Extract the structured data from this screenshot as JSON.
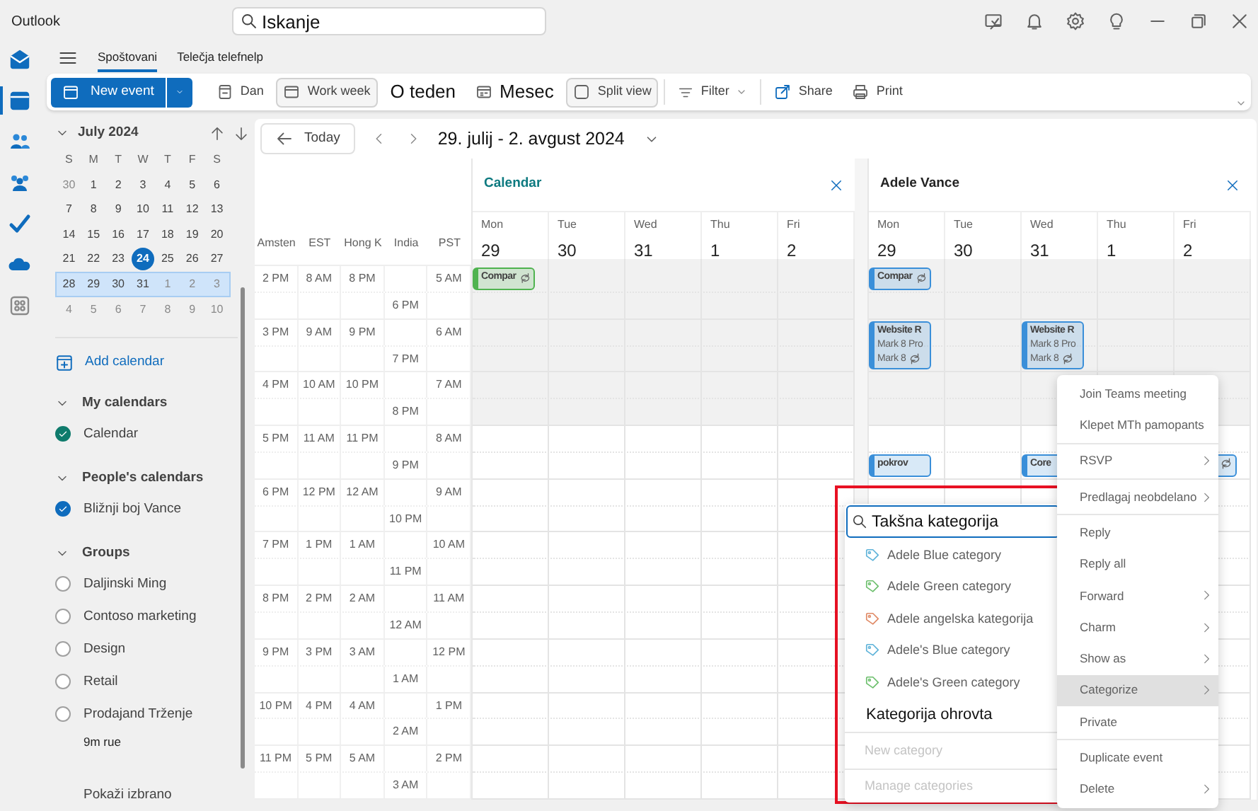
{
  "title_bar": {
    "app_name": "Outlook",
    "search": {
      "placeholder": "Iskanje"
    }
  },
  "ribbon_tabs": [
    {
      "label": "Spoštovani",
      "selected": true
    },
    {
      "label": "Telečja telefnelp",
      "selected": false
    }
  ],
  "toolbar": {
    "new_event": {
      "label": "New event"
    },
    "views": [
      {
        "label": "Dan",
        "selected": false
      },
      {
        "label": "Work week",
        "selected": true
      },
      {
        "label": "O teden",
        "selected": false
      },
      {
        "label": "Mesec",
        "selected": false
      },
      {
        "label": "Split view",
        "selected": true
      }
    ],
    "filter": {
      "label": "Filter"
    },
    "actions": [
      {
        "label": "Share"
      },
      {
        "label": "Print"
      }
    ]
  },
  "mini_calendar": {
    "month": "July 2024",
    "weekdays": [
      "S",
      "M",
      "T",
      "W",
      "T",
      "F",
      "S"
    ],
    "weeks": [
      {
        "selected": false,
        "days": [
          {
            "day": "30",
            "outside": true,
            "today": false
          },
          {
            "day": "1",
            "outside": false,
            "today": false
          },
          {
            "day": "2",
            "outside": false,
            "today": false
          },
          {
            "day": "3",
            "outside": false,
            "today": false
          },
          {
            "day": "4",
            "outside": false,
            "today": false
          },
          {
            "day": "5",
            "outside": false,
            "today": false
          },
          {
            "day": "6",
            "outside": false,
            "today": false
          }
        ]
      },
      {
        "selected": false,
        "days": [
          {
            "day": "7",
            "outside": false,
            "today": false
          },
          {
            "day": "8",
            "outside": false,
            "today": false
          },
          {
            "day": "9",
            "outside": false,
            "today": false
          },
          {
            "day": "10",
            "outside": false,
            "today": false
          },
          {
            "day": "11",
            "outside": false,
            "today": false
          },
          {
            "day": "12",
            "outside": false,
            "today": false
          },
          {
            "day": "13",
            "outside": false,
            "today": false
          }
        ]
      },
      {
        "selected": false,
        "days": [
          {
            "day": "14",
            "outside": false,
            "today": false
          },
          {
            "day": "15",
            "outside": false,
            "today": false
          },
          {
            "day": "16",
            "outside": false,
            "today": false
          },
          {
            "day": "17",
            "outside": false,
            "today": false
          },
          {
            "day": "18",
            "outside": false,
            "today": false
          },
          {
            "day": "19",
            "outside": false,
            "today": false
          },
          {
            "day": "20",
            "outside": false,
            "today": false
          }
        ]
      },
      {
        "selected": false,
        "days": [
          {
            "day": "21",
            "outside": false,
            "today": false
          },
          {
            "day": "22",
            "outside": false,
            "today": false
          },
          {
            "day": "23",
            "outside": false,
            "today": false
          },
          {
            "day": "24",
            "outside": false,
            "today": true
          },
          {
            "day": "25",
            "outside": false,
            "today": false
          },
          {
            "day": "26",
            "outside": false,
            "today": false
          },
          {
            "day": "27",
            "outside": false,
            "today": false
          }
        ]
      },
      {
        "selected": true,
        "days": [
          {
            "day": "28",
            "outside": false,
            "today": false
          },
          {
            "day": "29",
            "outside": false,
            "today": false
          },
          {
            "day": "30",
            "outside": false,
            "today": false
          },
          {
            "day": "31",
            "outside": false,
            "today": false
          },
          {
            "day": "1",
            "outside": true,
            "today": false
          },
          {
            "day": "2",
            "outside": true,
            "today": false
          },
          {
            "day": "3",
            "outside": true,
            "today": false
          }
        ]
      },
      {
        "selected": false,
        "days": [
          {
            "day": "4",
            "outside": true,
            "today": false
          },
          {
            "day": "5",
            "outside": true,
            "today": false
          },
          {
            "day": "6",
            "outside": true,
            "today": false
          },
          {
            "day": "7",
            "outside": true,
            "today": false
          },
          {
            "day": "8",
            "outside": true,
            "today": false
          },
          {
            "day": "9",
            "outside": true,
            "today": false
          },
          {
            "day": "10",
            "outside": true,
            "today": false
          }
        ]
      }
    ]
  },
  "add_calendar": "Add calendar",
  "calendar_groups": [
    {
      "title": "My calendars",
      "expanded": true,
      "items": [
        {
          "label": "Calendar",
          "checked": true,
          "color": "#0f7b6c"
        }
      ]
    },
    {
      "title": "People's calendars",
      "expanded": true,
      "items": [
        {
          "label": "Bližnji boj Vance",
          "checked": true,
          "color": "#0f6cbd"
        }
      ]
    },
    {
      "title": "Groups",
      "expanded": true,
      "items": [
        {
          "label": "Daljinski Ming",
          "checked": false
        },
        {
          "label": "Contoso marketing",
          "checked": false
        },
        {
          "label": "Design",
          "checked": false
        },
        {
          "label": "Retail",
          "checked": false
        },
        {
          "label": "Prodajand Trženje",
          "checked": false
        }
      ]
    }
  ],
  "groups_footer": "9m rue",
  "show_selected": "Pokaži izbrano",
  "navigation": {
    "today": "Today",
    "date_range": "29. julij - 2. avgust 2024"
  },
  "time_zones": {
    "columns": [
      "Amsten",
      "EST",
      "Hong K",
      "India",
      "PST"
    ],
    "rows": [
      {
        "amsterdam": "2 PM",
        "est": "8 AM",
        "hong_kong": "8 PM",
        "india": "6 PM",
        "pst": "5 AM",
        "shaded": true
      },
      {
        "amsterdam": "3 PM",
        "est": "9 AM",
        "hong_kong": "9 PM",
        "india": "7 PM",
        "pst": "6 AM",
        "shaded": true
      },
      {
        "amsterdam": "4 PM",
        "est": "10 AM",
        "hong_kong": "10 PM",
        "india": "8 PM",
        "pst": "7 AM",
        "shaded": true
      },
      {
        "amsterdam": "5 PM",
        "est": "11 AM",
        "hong_kong": "11 PM",
        "india": "9 PM",
        "pst": "8 AM",
        "shaded": false
      },
      {
        "amsterdam": "6 PM",
        "est": "12 PM",
        "hong_kong": "12 AM",
        "india": "10 PM",
        "pst": "9 AM",
        "shaded": false
      },
      {
        "amsterdam": "7 PM",
        "est": "1 PM",
        "hong_kong": "1 AM",
        "india": "11 PM",
        "pst": "10 AM",
        "shaded": false
      },
      {
        "amsterdam": "8 PM",
        "est": "2 PM",
        "hong_kong": "2 AM",
        "india": "12 AM",
        "pst": "11 AM",
        "shaded": false
      },
      {
        "amsterdam": "9 PM",
        "est": "3 PM",
        "hong_kong": "3 AM",
        "india": "1 AM",
        "pst": "12 PM",
        "shaded": false
      },
      {
        "amsterdam": "10 PM",
        "est": "4 PM",
        "hong_kong": "4 AM",
        "india": "2 AM",
        "pst": "1 PM",
        "shaded": false
      },
      {
        "amsterdam": "11 PM",
        "est": "5 PM",
        "hong_kong": "5 AM",
        "india": "3 AM",
        "pst": "2 PM",
        "shaded": false
      }
    ]
  },
  "panels": [
    {
      "title": "Calendar",
      "color": "#0e7a80",
      "days": [
        {
          "name": "Mon",
          "number": "29",
          "slots": [
            {
              "kind": "short_event",
              "title": "Compar",
              "recurring": true,
              "color": "#4fb34f"
            }
          ]
        },
        {
          "name": "Tue",
          "number": "30"
        },
        {
          "name": "Wed",
          "number": "31"
        },
        {
          "name": "Thu",
          "number": "1"
        },
        {
          "name": "Fri",
          "number": "2"
        }
      ]
    },
    {
      "title": "Adele Vance",
      "color": "#242424",
      "days": [
        {
          "name": "Mon",
          "number": "29",
          "slots": [
            {
              "kind": "short_event",
              "title": "Compar",
              "recurring": true,
              "color": "#3a8fd9"
            },
            {
              "kind": "empty"
            },
            {
              "kind": "long_event",
              "title": "Website R",
              "details": [
                "Mark 8 Pro",
                "Mark 8"
              ],
              "recurring": true,
              "color": "#3a8fd9"
            },
            {
              "kind": "empty"
            },
            {
              "kind": "empty"
            },
            {
              "kind": "empty"
            },
            {
              "kind": "short_event",
              "title": "pokrov",
              "recurring": false,
              "color": "#3a8fd9"
            }
          ]
        },
        {
          "name": "Tue",
          "number": "30"
        },
        {
          "name": "Wed",
          "number": "31",
          "slots": [
            {
              "kind": "empty"
            },
            {
              "kind": "empty"
            },
            {
              "kind": "long_event",
              "title": "Website R",
              "details": [
                "Mark 8 Pro",
                "Mark 8"
              ],
              "recurring": true,
              "color": "#3a8fd9"
            },
            {
              "kind": "empty"
            },
            {
              "kind": "empty"
            },
            {
              "kind": "empty"
            },
            {
              "kind": "short_event",
              "title": "Core",
              "recurring": false,
              "color": "#3a8fd9"
            }
          ]
        },
        {
          "name": "Thu",
          "number": "1"
        },
        {
          "name": "Fri",
          "number": "2",
          "slots": [
            {
              "kind": "empty"
            },
            {
              "kind": "empty"
            },
            {
              "kind": "empty"
            },
            {
              "kind": "empty"
            },
            {
              "kind": "empty"
            },
            {
              "kind": "empty"
            },
            {
              "kind": "empty"
            },
            {
              "kind": "short_event",
              "recurring": true,
              "color": "#3a8fd9"
            }
          ]
        }
      ]
    }
  ],
  "context_menu": {
    "items": [
      {
        "kind": "item",
        "label": "Join Teams meeting",
        "submenu": false,
        "selected": false
      },
      {
        "kind": "item",
        "label": "Klepet MTh pamopants",
        "submenu": false,
        "selected": false
      },
      {
        "kind": "separator"
      },
      {
        "kind": "item",
        "label": "RSVP",
        "submenu": true,
        "selected": false
      },
      {
        "kind": "separator"
      },
      {
        "kind": "item",
        "label": "Predlagaj neobdelano",
        "submenu": true,
        "selected": false
      },
      {
        "kind": "separator"
      },
      {
        "kind": "item",
        "label": "Reply",
        "submenu": false,
        "selected": false
      },
      {
        "kind": "item",
        "label": "Reply all",
        "submenu": false,
        "selected": false
      },
      {
        "kind": "item",
        "label": "Forward",
        "submenu": true,
        "selected": false
      },
      {
        "kind": "item",
        "label": "Charm",
        "submenu": true,
        "selected": false
      },
      {
        "kind": "item",
        "label": "Show as",
        "submenu": true,
        "selected": false
      },
      {
        "kind": "item",
        "label": "Categorize",
        "submenu": true,
        "selected": true
      },
      {
        "kind": "item",
        "label": "Private",
        "submenu": false,
        "selected": false
      },
      {
        "kind": "separator"
      },
      {
        "kind": "item",
        "label": "Duplicate event",
        "submenu": false,
        "selected": false
      },
      {
        "kind": "item",
        "label": "Delete",
        "submenu": true,
        "selected": false
      }
    ]
  },
  "category_menu": {
    "search": {
      "value": "Takšna kategorija"
    },
    "items": [
      {
        "kind": "tag",
        "label": "Adele Blue category",
        "color": "#5fb3d9"
      },
      {
        "kind": "tag",
        "label": "Adele Green category",
        "color": "#6cbf6c"
      },
      {
        "kind": "tag",
        "label": "Adele angelska kategorija",
        "color": "#e08a66"
      },
      {
        "kind": "tag",
        "label": "Adele's Blue category",
        "color": "#5fb3d9"
      },
      {
        "kind": "tag",
        "label": "Adele's Green category",
        "color": "#6cbf6c"
      },
      {
        "kind": "plain",
        "label": "Kategorija ohrovta"
      }
    ],
    "actions": [
      {
        "label": "New category",
        "disabled": true
      },
      {
        "label": "Manage categories",
        "disabled": true
      }
    ]
  }
}
